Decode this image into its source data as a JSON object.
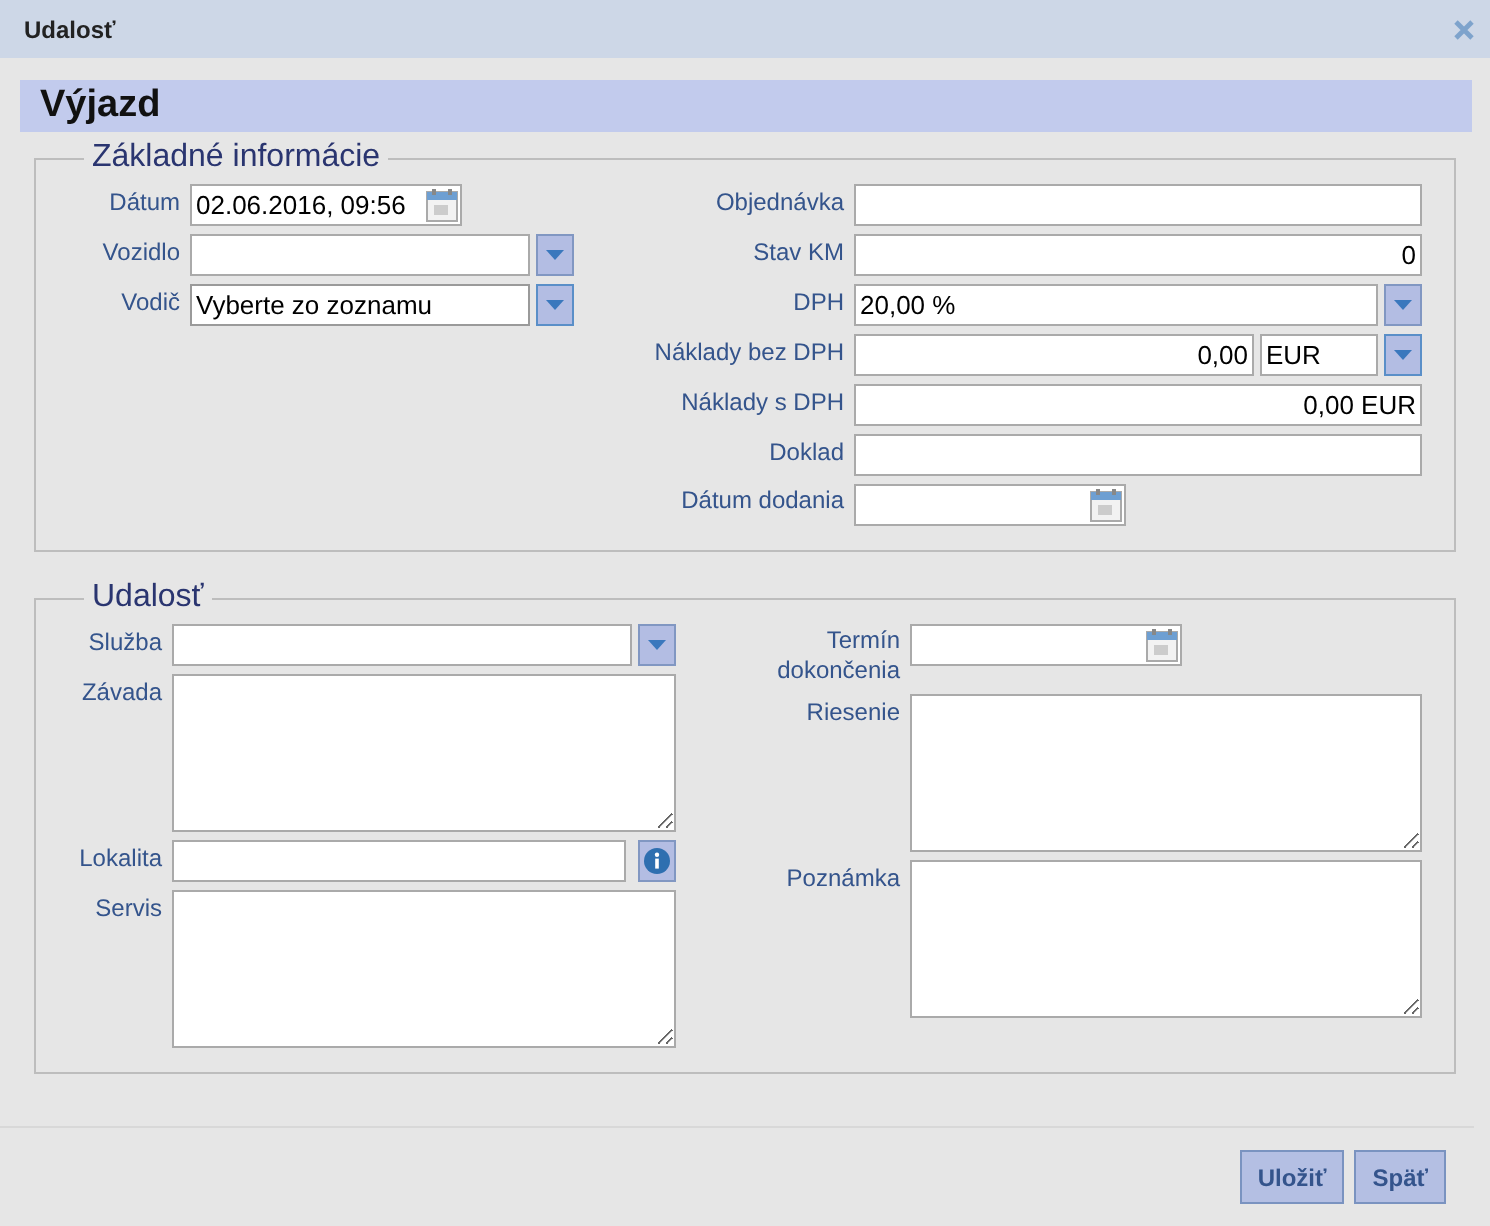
{
  "window": {
    "title": "Udalosť"
  },
  "heading": "Výjazd",
  "sections": [
    {
      "legend": "Základné informácie",
      "columns": [
        [
          {
            "label": "Dátum",
            "kind": "date",
            "value": "02.06.2016, 09:56"
          },
          {
            "label": "Vozidlo",
            "kind": "select"
          },
          {
            "label": "Vodič",
            "kind": "select",
            "value": "Vyberte zo zoznamu",
            "focused": true
          }
        ],
        [
          {
            "label": "Objednávka",
            "kind": "text"
          },
          {
            "label": "Stav KM",
            "kind": "number",
            "value": "0"
          },
          {
            "label": "DPH",
            "kind": "select",
            "value": "20,00 %"
          },
          {
            "label": "Náklady bez DPH",
            "kind": "amount",
            "value": "0,00",
            "currency": "EUR"
          },
          {
            "label": "Náklady s DPH",
            "kind": "number",
            "value": "0,00 EUR"
          },
          {
            "label": "Doklad",
            "kind": "text"
          },
          {
            "label": "Dátum dodania",
            "kind": "date"
          }
        ]
      ]
    },
    {
      "legend": "Udalosť",
      "columns": [
        [
          {
            "label": "Služba",
            "kind": "select"
          },
          {
            "label": "Závada",
            "kind": "textarea"
          },
          {
            "label": "Lokalita",
            "kind": "lookup"
          },
          {
            "label": "Servis",
            "kind": "textarea"
          }
        ],
        [
          {
            "label": "Termín dokončenia",
            "kind": "date"
          },
          {
            "label": "Riesenie",
            "kind": "textarea"
          },
          {
            "label": "Poznámka",
            "kind": "textarea"
          }
        ]
      ]
    }
  ],
  "buttons": [
    "Uložiť",
    "Späť"
  ]
}
